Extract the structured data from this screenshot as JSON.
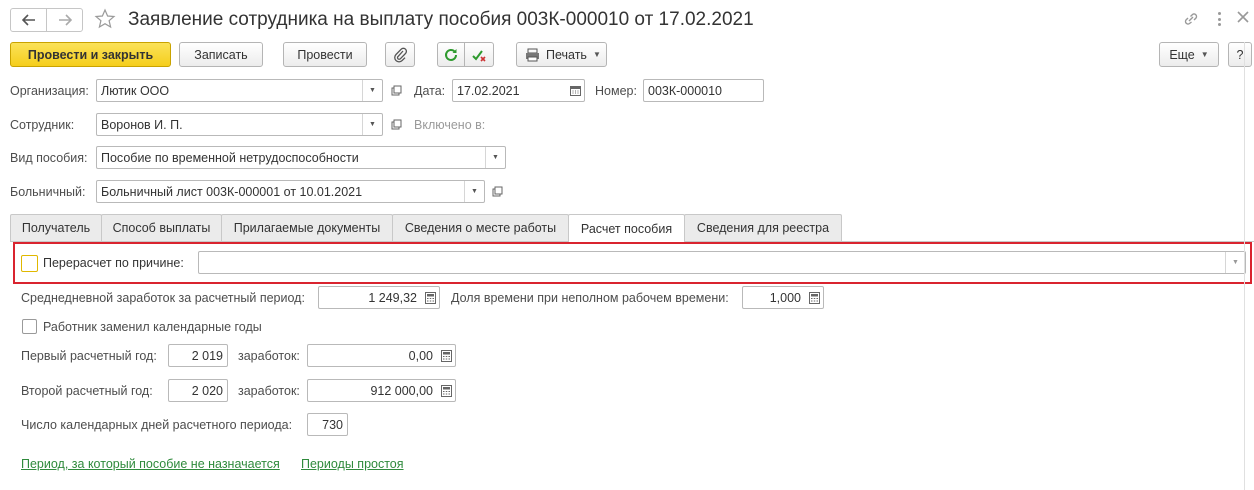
{
  "window": {
    "title": "Заявление сотрудника на выплату пособия 003К-000010 от 17.02.2021"
  },
  "toolbar": {
    "post_and_close": "Провести и закрыть",
    "save": "Записать",
    "post": "Провести",
    "print": "Печать",
    "more": "Еще",
    "help": "?"
  },
  "header": {
    "organization_label": "Организация:",
    "organization_value": "Лютик ООО",
    "date_label": "Дата:",
    "date_value": "17.02.2021",
    "number_label": "Номер:",
    "number_value": "003К-000010",
    "employee_label": "Сотрудник:",
    "employee_value": "Воронов И. П.",
    "included_label": "Включено в:",
    "benefit_type_label": "Вид пособия:",
    "benefit_type_value": "Пособие по временной нетрудоспособности",
    "sick_leave_label": "Больничный:",
    "sick_leave_value": "Больничный лист 003К-000001 от 10.01.2021"
  },
  "tabs": [
    {
      "label": "Получатель"
    },
    {
      "label": "Способ выплаты"
    },
    {
      "label": "Прилагаемые документы"
    },
    {
      "label": "Сведения о месте работы"
    },
    {
      "label": "Расчет пособия"
    },
    {
      "label": "Сведения для реестра"
    }
  ],
  "calc": {
    "recalc_label": "Перерасчет по причине:",
    "recalc_value": "",
    "avg_daily_label": "Среднедневной заработок за расчетный период:",
    "avg_daily_value": "1 249,32",
    "part_time_label": "Доля времени при неполном рабочем времени:",
    "part_time_value": "1,000",
    "replaced_years_label": "Работник заменил календарные годы",
    "first_year_label": "Первый расчетный год:",
    "first_year_value": "2 019",
    "first_earnings_label": "заработок:",
    "first_earnings_value": "0,00",
    "second_year_label": "Второй расчетный год:",
    "second_year_value": "2 020",
    "second_earnings_label": "заработок:",
    "second_earnings_value": "912 000,00",
    "days_label": "Число календарных дней расчетного периода:",
    "days_value": "730",
    "link_no_benefit": "Период, за который пособие не назначается",
    "link_idle": "Периоды простоя"
  },
  "colors": {
    "primary_button": "#f5ce1c",
    "highlight_border": "#d9242f",
    "link": "#2f8a3c"
  }
}
